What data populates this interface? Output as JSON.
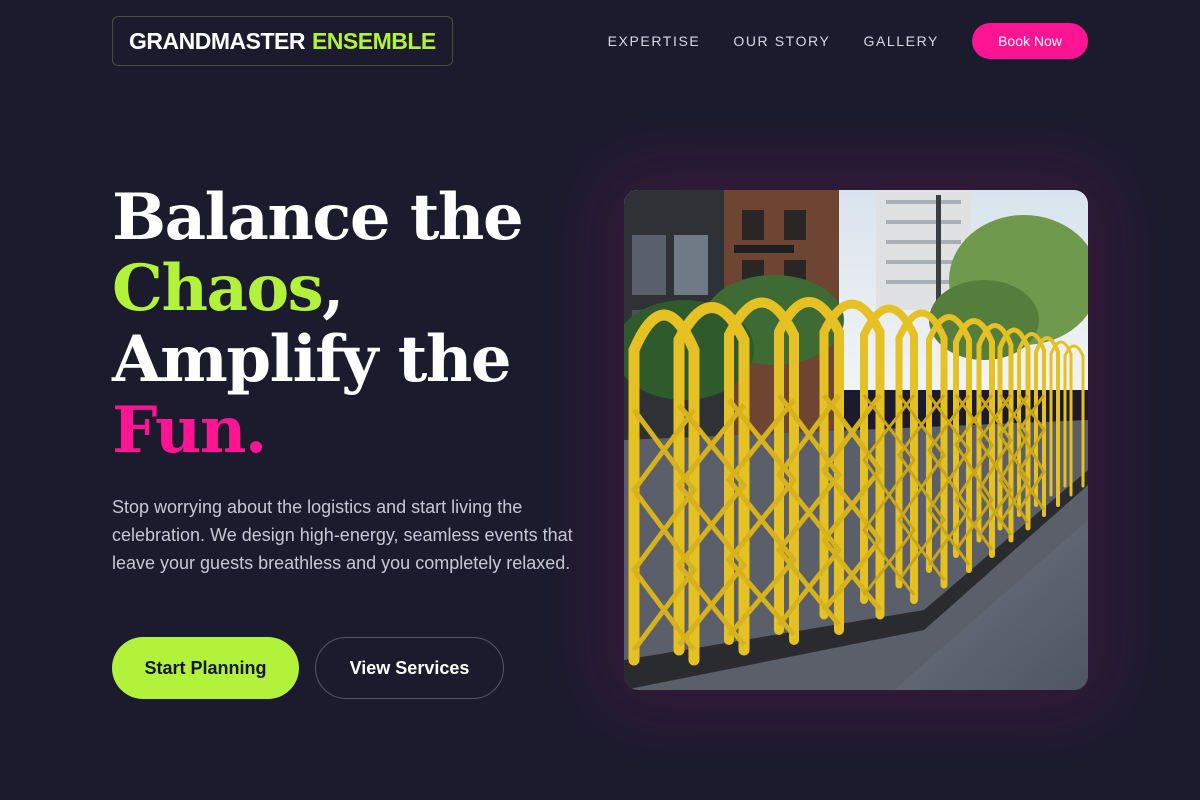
{
  "brand": {
    "name_part1": "GRANDMASTER",
    "name_part2": "ENSEMBLE"
  },
  "nav": {
    "links": [
      "EXPERTISE",
      "OUR STORY",
      "GALLERY"
    ],
    "cta_label": "Book Now"
  },
  "hero": {
    "headline_line1": "Balance the",
    "headline_word_chaos": "Chaos",
    "headline_comma": ",",
    "headline_line3": "Amplify the",
    "headline_word_fun": "Fun",
    "headline_period": ".",
    "subtext": "Stop worrying about the logistics and start living the celebration. We design high-energy, seamless events that leave your guests breathless and you completely relaxed.",
    "primary_button": "Start Planning",
    "secondary_button": "View Services"
  },
  "colors": {
    "background": "#1c1b2e",
    "accent_green": "#b3f23a",
    "accent_pink": "#ff1493"
  }
}
